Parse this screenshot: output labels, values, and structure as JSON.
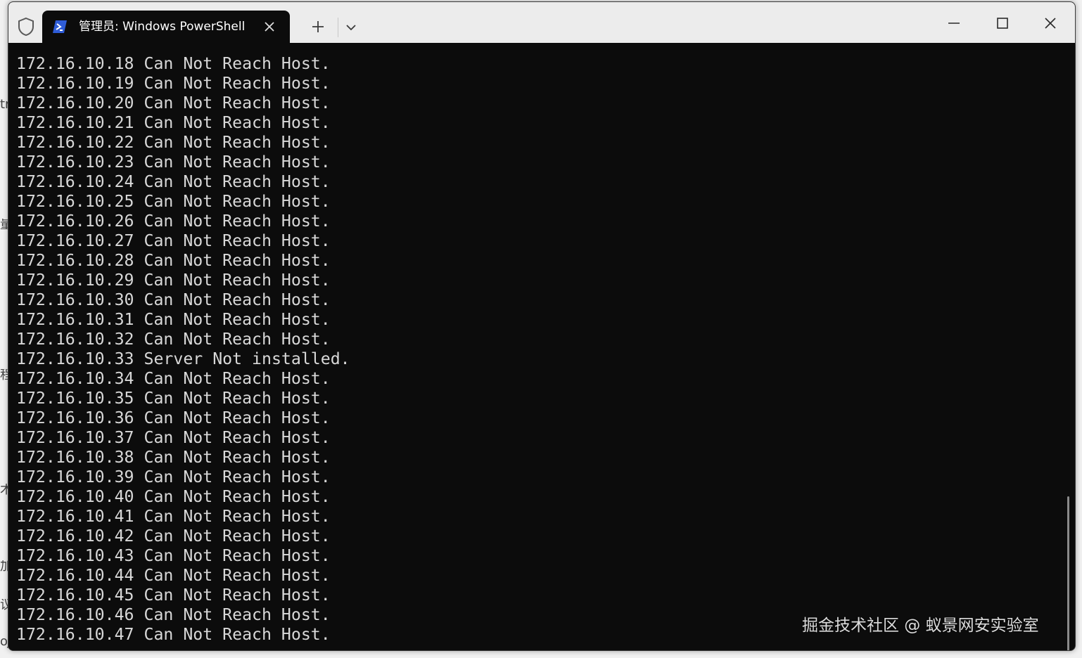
{
  "window": {
    "tab_title": "管理员: Windows PowerShell"
  },
  "icons": {
    "shield": "shield-icon",
    "tab": "powershell-icon",
    "tab_close": "close-icon",
    "new_tab": "plus-icon",
    "dropdown": "chevron-down-icon",
    "minimize": "minimize-icon",
    "maximize": "maximize-icon",
    "close": "close-icon"
  },
  "colors": {
    "terminal_bg": "#0c0c0c",
    "terminal_fg": "#d8d8d8",
    "titlebar_bg": "#ececec",
    "powershell_blue": "#2f5dd8"
  },
  "terminal": {
    "lines": [
      "172.16.10.18 Can Not Reach Host.",
      "172.16.10.19 Can Not Reach Host.",
      "172.16.10.20 Can Not Reach Host.",
      "172.16.10.21 Can Not Reach Host.",
      "172.16.10.22 Can Not Reach Host.",
      "172.16.10.23 Can Not Reach Host.",
      "172.16.10.24 Can Not Reach Host.",
      "172.16.10.25 Can Not Reach Host.",
      "172.16.10.26 Can Not Reach Host.",
      "172.16.10.27 Can Not Reach Host.",
      "172.16.10.28 Can Not Reach Host.",
      "172.16.10.29 Can Not Reach Host.",
      "172.16.10.30 Can Not Reach Host.",
      "172.16.10.31 Can Not Reach Host.",
      "172.16.10.32 Can Not Reach Host.",
      "172.16.10.33 Server Not installed.",
      "172.16.10.34 Can Not Reach Host.",
      "172.16.10.35 Can Not Reach Host.",
      "172.16.10.36 Can Not Reach Host.",
      "172.16.10.37 Can Not Reach Host.",
      "172.16.10.38 Can Not Reach Host.",
      "172.16.10.39 Can Not Reach Host.",
      "172.16.10.40 Can Not Reach Host.",
      "172.16.10.41 Can Not Reach Host.",
      "172.16.10.42 Can Not Reach Host.",
      "172.16.10.43 Can Not Reach Host.",
      "172.16.10.44 Can Not Reach Host.",
      "172.16.10.45 Can Not Reach Host.",
      "172.16.10.46 Can Not Reach Host.",
      "172.16.10.47 Can Not Reach Host."
    ]
  },
  "watermark": "掘金技术社区 @ 蚁景网安实验室",
  "background_peek": {
    "chars": [
      "tr",
      "量",
      "程",
      "术",
      "加",
      "议",
      "oJ"
    ]
  }
}
